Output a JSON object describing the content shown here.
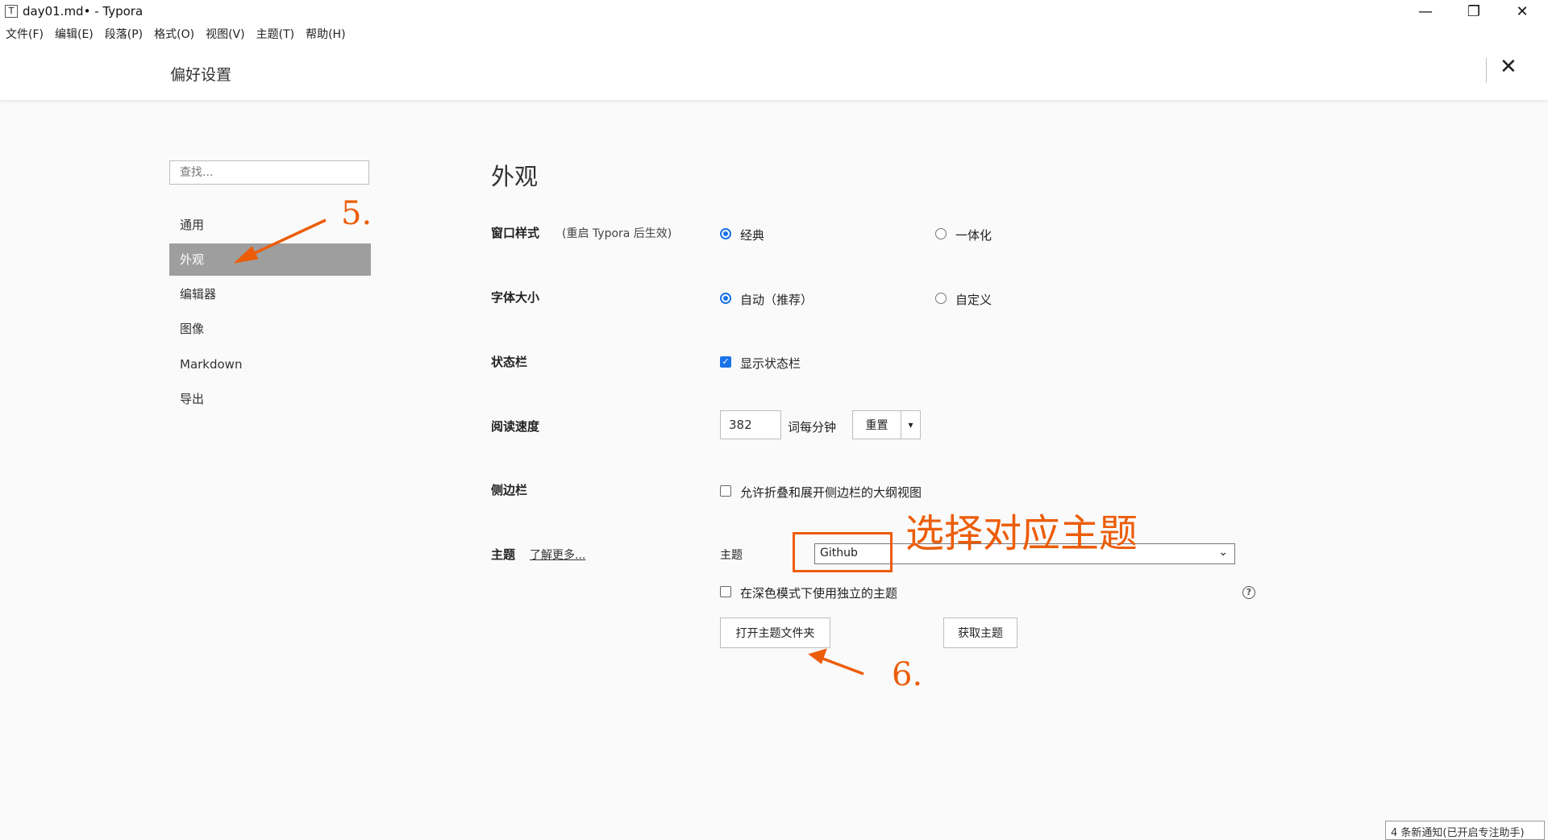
{
  "window": {
    "app_icon": "T",
    "title": "day01.md• - Typora",
    "minimize": "—",
    "maximize": "❐",
    "close": "✕"
  },
  "menu": [
    "文件(F)",
    "编辑(E)",
    "段落(P)",
    "格式(O)",
    "视图(V)",
    "主题(T)",
    "帮助(H)"
  ],
  "prefs": {
    "title": "偏好设置",
    "close": "✕",
    "search_placeholder": "查找...",
    "nav": [
      "通用",
      "外观",
      "编辑器",
      "图像",
      "Markdown",
      "导出"
    ],
    "active_nav": "外观"
  },
  "appearance": {
    "title": "外观",
    "window_style": {
      "label": "窗口样式",
      "hint": "(重启 Typora 后生效)",
      "options": [
        "经典",
        "一体化"
      ],
      "selected": "经典"
    },
    "font_size": {
      "label": "字体大小",
      "options": [
        "自动（推荐）",
        "自定义"
      ],
      "selected": "自动（推荐）"
    },
    "status_bar": {
      "label": "状态栏",
      "checkbox_label": "显示状态栏",
      "checked": true
    },
    "reading_speed": {
      "label": "阅读速度",
      "value": "382",
      "unit": "词每分钟",
      "reset_button": "重置",
      "dropdown_arrow": "▾"
    },
    "sidebar": {
      "label": "侧边栏",
      "checkbox_label": "允许折叠和展开侧边栏的大纲视图",
      "checked": false
    },
    "theme": {
      "label": "主题",
      "learn_more": "了解更多...",
      "select_label": "主题",
      "selected": "Github",
      "dark_mode_label": "在深色模式下使用独立的主题",
      "dark_mode_checked": false,
      "help": "?",
      "open_folder_button": "打开主题文件夹",
      "get_themes_button": "获取主题"
    }
  },
  "annotations": {
    "step5": "5.",
    "step6": "6.",
    "select_theme": "选择对应主题",
    "color": "#ec5d0a"
  },
  "notification": "4 条新通知(已开启专注助手)"
}
